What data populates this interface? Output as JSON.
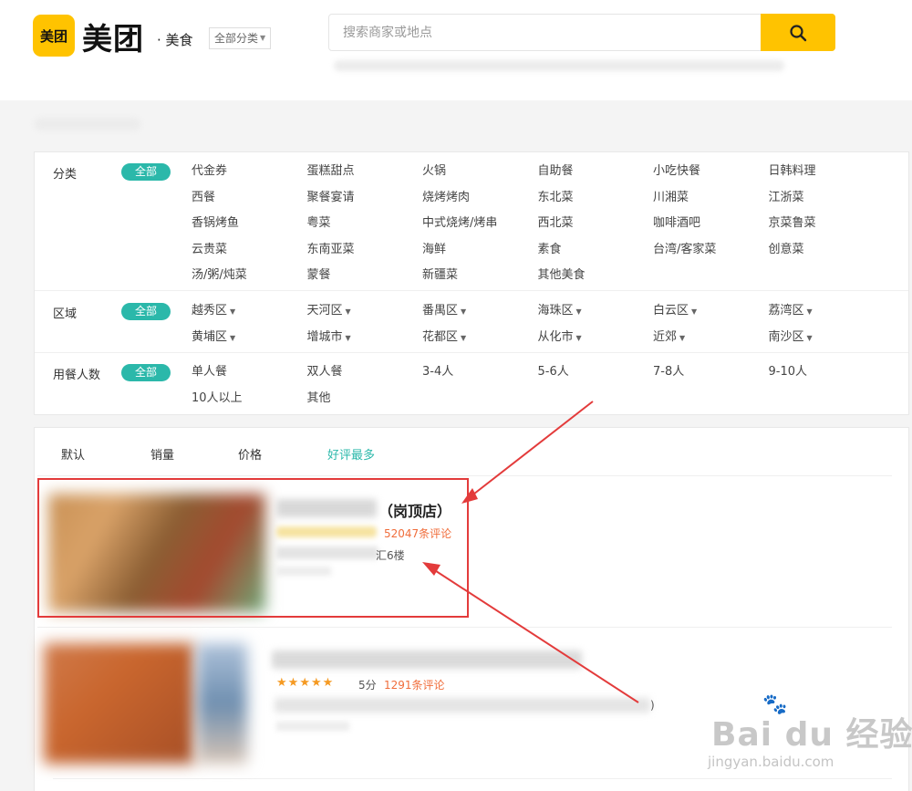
{
  "header": {
    "logo_badge": "美团",
    "logo_text": "美团",
    "logo_sub": "· 美食",
    "category_select": "全部分类",
    "search_placeholder": "搜索商家或地点",
    "search_icon": "search-icon"
  },
  "filters": {
    "all_label": "全部",
    "category": {
      "label": "分类",
      "items": [
        "代金券",
        "蛋糕甜点",
        "火锅",
        "自助餐",
        "小吃快餐",
        "日韩料理",
        "西餐",
        "聚餐宴请",
        "烧烤烤肉",
        "东北菜",
        "川湘菜",
        "江浙菜",
        "香锅烤鱼",
        "粤菜",
        "中式烧烤/烤串",
        "西北菜",
        "咖啡酒吧",
        "京菜鲁菜",
        "云贵菜",
        "东南亚菜",
        "海鲜",
        "素食",
        "台湾/客家菜",
        "创意菜",
        "汤/粥/炖菜",
        "蒙餐",
        "新疆菜",
        "其他美食"
      ]
    },
    "region": {
      "label": "区域",
      "items": [
        "越秀区",
        "天河区",
        "番禺区",
        "海珠区",
        "白云区",
        "荔湾区",
        "黄埔区",
        "增城市",
        "花都区",
        "从化市",
        "近郊",
        "南沙区"
      ]
    },
    "diners": {
      "label": "用餐人数",
      "items": [
        "单人餐",
        "双人餐",
        "3-4人",
        "5-6人",
        "7-8人",
        "9-10人",
        "10人以上",
        "其他"
      ]
    }
  },
  "sort": {
    "tabs": [
      "默认",
      "销量",
      "价格",
      "好评最多"
    ],
    "active_index": 3
  },
  "results": [
    {
      "branch": "（岗顶店）",
      "reviews": "52047条评论",
      "address_tail": "汇6楼"
    },
    {
      "rating_stars": 5,
      "score": "5分",
      "reviews": "1291条评论",
      "address_tail": ")"
    }
  ],
  "colors": {
    "brand_yellow": "#ffc300",
    "accent_teal": "#2bb8aa",
    "review_orange": "#f06d3b",
    "star_orange": "#f59a23",
    "annotation_red": "#e33b3b"
  },
  "watermark": {
    "logo": "Bai du 经验",
    "url": "jingyan.baidu.com"
  }
}
